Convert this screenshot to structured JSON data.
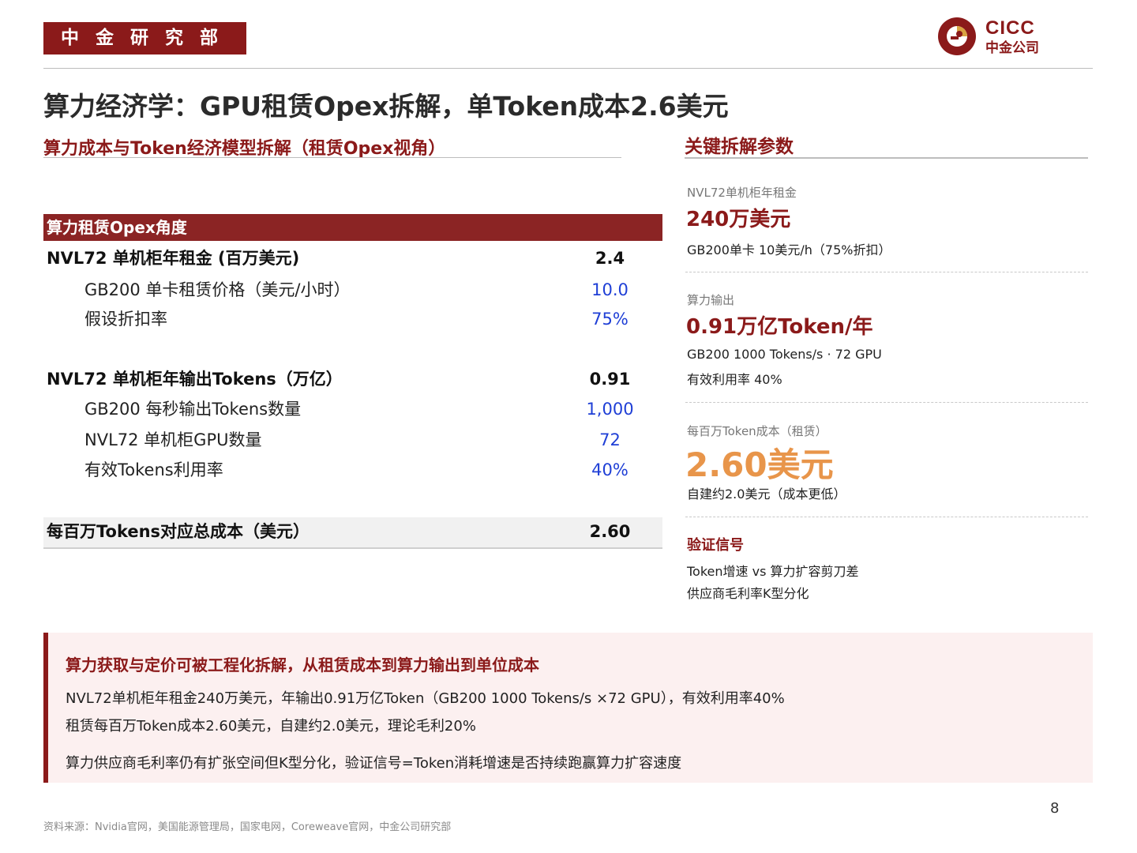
{
  "header": {
    "department": "中金研究部",
    "logo_latin": "CICC",
    "logo_cn": "中金公司",
    "brand_color": "#8b1a1a"
  },
  "title": "算力经济学：GPU租赁Opex拆解，单Token成本2.6美元",
  "left_section": {
    "heading": "算力成本与Token经济模型拆解（租赁Opex视角）",
    "table": {
      "header": "算力租赁Opex角度",
      "rows": [
        {
          "label": "NVL72 单机柜年租金 (百万美元)",
          "value": "2.4",
          "style": "main"
        },
        {
          "label": "GB200 单卡租赁价格（美元/小时）",
          "value": "10.0",
          "style": "sub"
        },
        {
          "label": "假设折扣率",
          "value": "75%",
          "style": "sub"
        },
        {
          "label": "NVL72 单机柜年输出Tokens（万亿）",
          "value": "0.91",
          "style": "main"
        },
        {
          "label": "GB200 每秒输出Tokens数量",
          "value": "1,000",
          "style": "sub"
        },
        {
          "label": "NVL72 单机柜GPU数量",
          "value": "72",
          "style": "sub"
        },
        {
          "label": "有效Tokens利用率",
          "value": "40%",
          "style": "sub"
        },
        {
          "label": "每百万Tokens对应总成本（美元）",
          "value": "2.60",
          "style": "total"
        }
      ]
    }
  },
  "right_panel": {
    "heading": "关键拆解参数",
    "rent": {
      "label": "NVL72单机柜年租金",
      "value": "240万美元",
      "note": "GB200单卡 10美元/h（75%折扣）"
    },
    "output": {
      "label": "算力输出",
      "value": "0.91万亿Token/年",
      "note1": "GB200 1000 Tokens/s · 72 GPU",
      "note2": "有效利用率 40%"
    },
    "cost": {
      "label": "每百万Token成本（租赁）",
      "value": "2.60美元",
      "note": "自建约2.0美元（成本更低）",
      "accent_color": "#e8954a"
    },
    "signal": {
      "label": "验证信号",
      "line1": "Token增速 vs 算力扩容剪刀差",
      "line2": "供应商毛利率K型分化"
    }
  },
  "callout": {
    "title": "算力获取与定价可被工程化拆解，从租赁成本到算力输出到单位成本",
    "line1": "NVL72单机柜年租金240万美元，年输出0.91万亿Token（GB200 1000 Tokens/s ×72 GPU），有效利用率40%",
    "line2": "租赁每百万Token成本2.60美元，自建约2.0美元，理论毛利20%",
    "line3": "算力供应商毛利率仍有扩张空间但K型分化，验证信号=Token消耗增速是否持续跑赢算力扩容速度"
  },
  "footer": {
    "page_number": "8",
    "source": "资料来源：Nvidia官网，美国能源管理局，国家电网，Coreweave官网，中金公司研究部"
  }
}
